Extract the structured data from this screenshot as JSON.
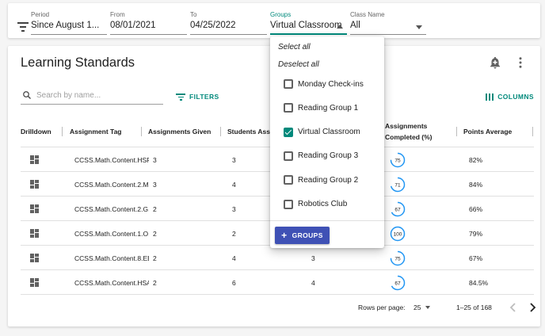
{
  "filters": {
    "period": {
      "label": "Period",
      "value": "Since August 1..."
    },
    "from": {
      "label": "From",
      "value": "08/01/2021"
    },
    "to": {
      "label": "To",
      "value": "04/25/2022"
    },
    "groups": {
      "label": "Groups",
      "value": "Virtual Classroom"
    },
    "class_name": {
      "label": "Class Name",
      "value": "All"
    }
  },
  "card": {
    "title": "Learning Standards",
    "search_placeholder": "Search by name...",
    "filters_label": "FILTERS",
    "columns_label": "COLUMNS"
  },
  "table": {
    "headers": {
      "drilldown": "Drilldown",
      "assignment_tag": "Assignment Tag",
      "assignments_given": "Assignments Given",
      "students_assigned": "Students Assi",
      "assignments_completed": "Assignments",
      "assignments_completed_2": "Completed (%)",
      "points_average": "Points Average"
    },
    "rows": [
      {
        "tag": "CCSS.Math.Content.HSF",
        "given": "3",
        "students": "3",
        "completed": "",
        "pct": 75,
        "avg": "82%"
      },
      {
        "tag": "CCSS.Math.Content.2.M",
        "given": "3",
        "students": "4",
        "completed": "",
        "pct": 71,
        "avg": "84%"
      },
      {
        "tag": "CCSS.Math.Content.2.G.",
        "given": "2",
        "students": "3",
        "completed": "",
        "pct": 67,
        "avg": "66%"
      },
      {
        "tag": "CCSS.Math.Content.1.O.",
        "given": "2",
        "students": "2",
        "completed": "",
        "pct": 100,
        "avg": "79%"
      },
      {
        "tag": "CCSS.Math.Content.8.EE",
        "given": "2",
        "students": "4",
        "completed": "3",
        "pct": 75,
        "avg": "67%"
      },
      {
        "tag": "CCSS.Math.Content.HSA",
        "given": "2",
        "students": "6",
        "completed": "4",
        "pct": 67,
        "avg": "84.5%"
      }
    ]
  },
  "pagination": {
    "rows_per_page_label": "Rows per page:",
    "rows_per_page": "25",
    "range": "1–25 of 168"
  },
  "groups_dropdown": {
    "select_all": "Select all",
    "deselect_all": "Deselect all",
    "items": [
      {
        "label": "Monday Check-ins",
        "checked": false
      },
      {
        "label": "Reading Group 1",
        "checked": false
      },
      {
        "label": "Virtual Classroom",
        "checked": true
      },
      {
        "label": "Reading Group 3",
        "checked": false
      },
      {
        "label": "Reading Group 2",
        "checked": false
      },
      {
        "label": "Robotics Club",
        "checked": false
      }
    ],
    "add_button": "GROUPS"
  },
  "colors": {
    "accent": "#00897b",
    "button": "#3f51b5",
    "gauge": "#2196f3"
  }
}
